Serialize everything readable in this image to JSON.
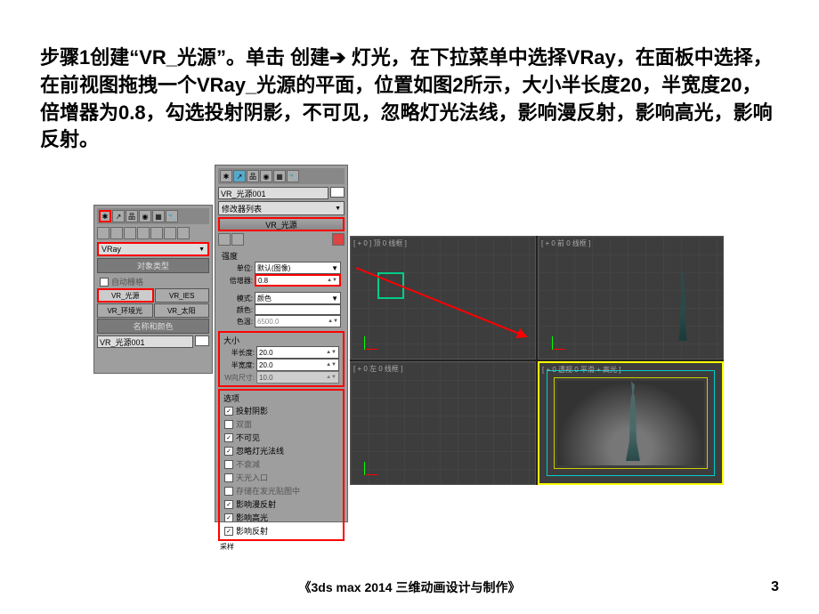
{
  "title": "步骤1创建“VR_光源”。单击 创建➔ 灯光，在下拉菜单中选择VRay，在面板中选择，在前视图拖拽一个VRay_光源的平面，位置如图2所示，大小半长度20，半宽度20，倍增器为0.8，勾选投射阴影，不可见，忽略灯光法线，影响漫反射，影响高光，影响反射。",
  "panel1": {
    "dropdown": "VRay",
    "section1": "对象类型",
    "autogrid": "自动栅格",
    "btn1": "VR_光源",
    "btn2": "VR_IES",
    "btn3": "VR_环境光",
    "btn4": "VR_太阳",
    "section2": "名称和颜色",
    "name": "VR_光源001"
  },
  "panel2": {
    "name": "VR_光源001",
    "modlist": "修改器列表",
    "rollout": "VR_光源",
    "intensity": "强度",
    "unit_label": "单位:",
    "unit_val": "默认(图像)",
    "mult_label": "倍增器:",
    "mult_val": "0.8",
    "mode_section": "模式:",
    "mode_val": "颜色",
    "color_label": "颜色:",
    "temp_label": "色温:",
    "temp_val": "6500.0",
    "size_section": "大小",
    "halflen_label": "半长度:",
    "halflen_val": "20.0",
    "halfwid_label": "半宽度:",
    "halfwid_val": "20.0",
    "wsize_label": "W向尺寸:",
    "wsize_val": "10.0",
    "options_section": "选项",
    "opt1": "投射阴影",
    "opt2": "双面",
    "opt3": "不可见",
    "opt4": "忽略灯光法线",
    "opt5": "不衰减",
    "opt6": "天光入口",
    "opt7": "存储在发光贴图中",
    "opt8": "影响漫反射",
    "opt9": "影响高光",
    "opt10": "影响反射",
    "sampling": "采样"
  },
  "viewports": {
    "vp1": "[ + 0 ] 顶 0 线框 ]",
    "vp2": "[ + 0 前 0 线框 ]",
    "vp3": "[ + 0 左 0 线框 ]",
    "vp4": "[ + 0 透视 0 平滑 + 高光 ]"
  },
  "footer": "《3ds max 2014 三维动画设计与制作》",
  "page": "3"
}
